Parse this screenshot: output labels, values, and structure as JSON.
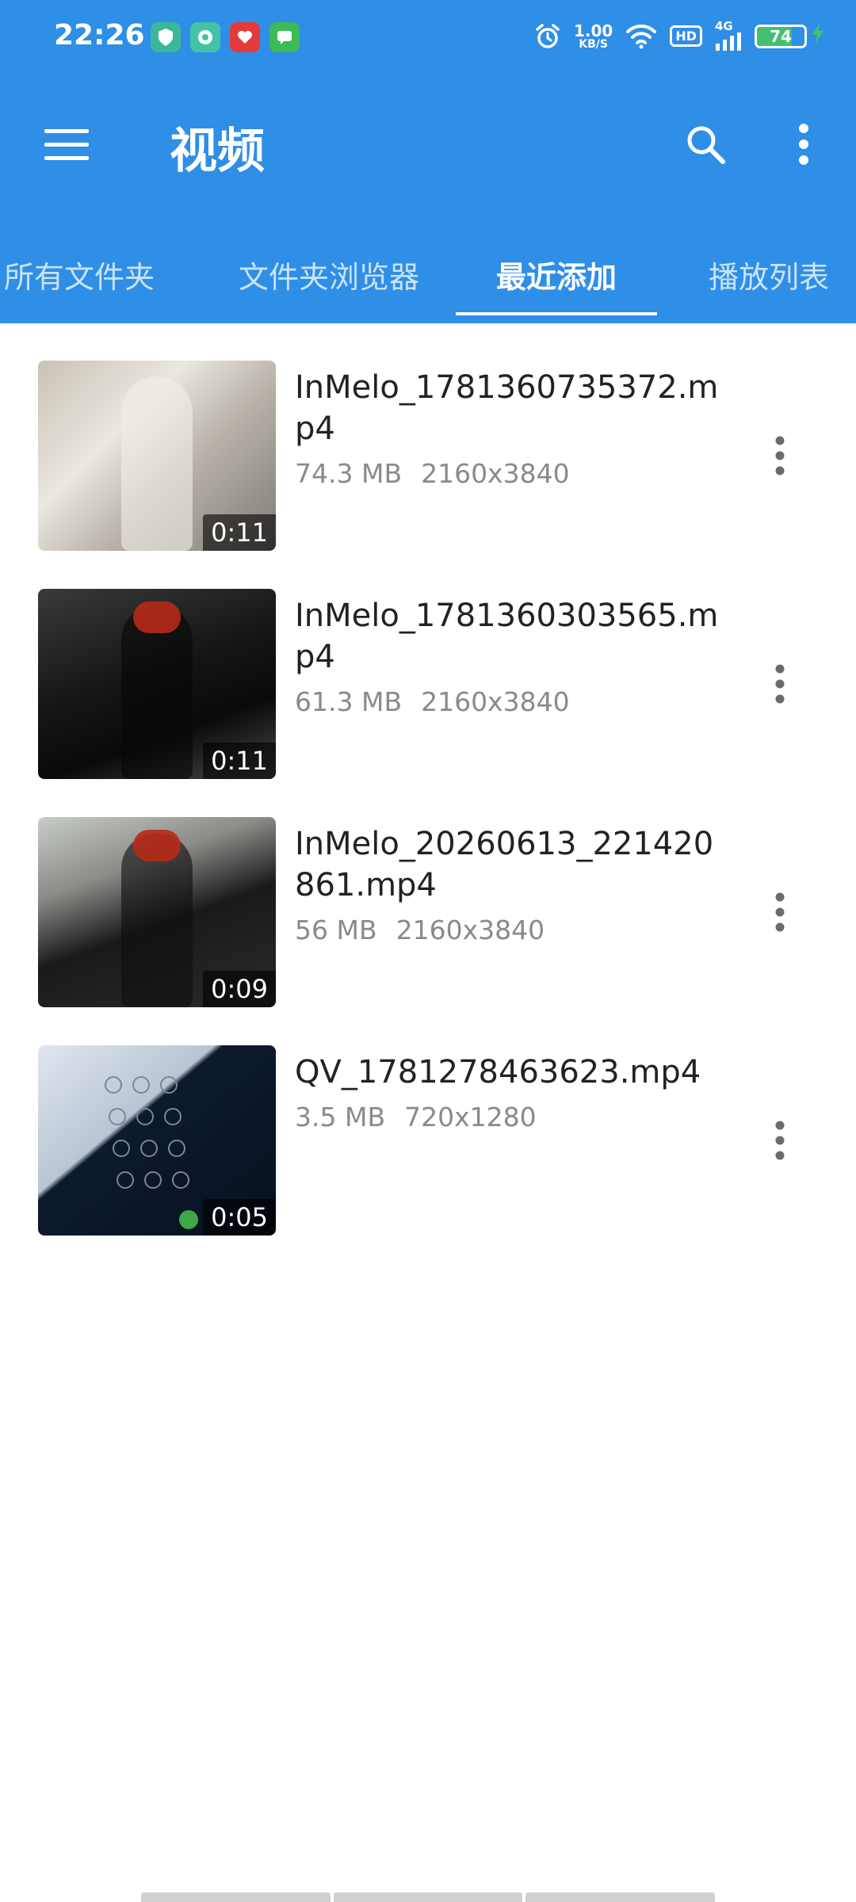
{
  "status_bar": {
    "time": "22:26",
    "net_speed_value": "1.00",
    "net_speed_unit": "KB/S",
    "hd_label": "HD",
    "signal_label": "4G",
    "battery_level": "74",
    "notification_icons": [
      "shield-app-icon",
      "chat-app-icon",
      "pinduoduo-app-icon",
      "messages-app-icon"
    ],
    "icons": [
      "alarm-icon",
      "wifi-icon",
      "signal-icon",
      "battery-icon",
      "charging-icon"
    ]
  },
  "toolbar": {
    "title": "视频",
    "icons": [
      "menu-icon",
      "search-icon",
      "more-vert-icon"
    ]
  },
  "tabs": [
    {
      "label": "所有文件夹",
      "active": false
    },
    {
      "label": "文件夹浏览器",
      "active": false
    },
    {
      "label": "最近添加",
      "active": true
    },
    {
      "label": "播放列表",
      "active": false
    }
  ],
  "videos": [
    {
      "title": "InMelo_1781360735372.mp4",
      "size": "74.3 MB",
      "resolution": "2160x3840",
      "duration": "0:11"
    },
    {
      "title": "InMelo_1781360303565.mp4",
      "size": "61.3 MB",
      "resolution": "2160x3840",
      "duration": "0:11"
    },
    {
      "title": "InMelo_20260613_221420861.mp4",
      "size": "56 MB",
      "resolution": "2160x3840",
      "duration": "0:09"
    },
    {
      "title": "QV_1781278463623.mp4",
      "size": "3.5 MB",
      "resolution": "720x1280",
      "duration": "0:05"
    }
  ],
  "colors": {
    "header": "#2f8ee6",
    "text_primary": "#222222",
    "text_secondary": "#8a8a8a",
    "battery_green": "#43c06e"
  }
}
